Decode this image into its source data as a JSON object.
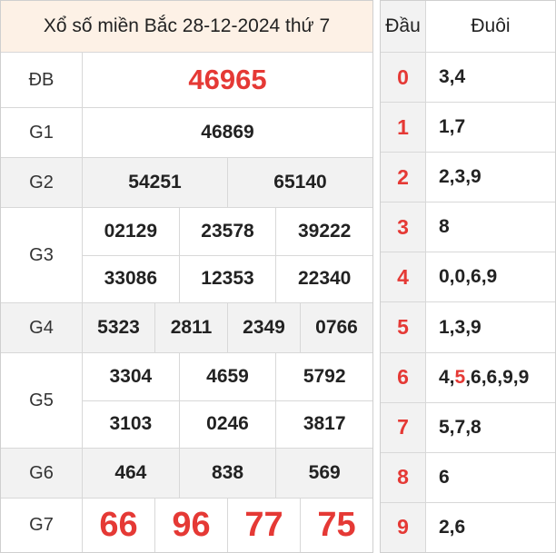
{
  "results": {
    "title": "Xổ số miền Bắc 28-12-2024 thứ 7",
    "prizes": {
      "db": {
        "label": "ĐB",
        "values": [
          "46965"
        ]
      },
      "g1": {
        "label": "G1",
        "values": [
          "46869"
        ]
      },
      "g2": {
        "label": "G2",
        "values": [
          "54251",
          "65140"
        ]
      },
      "g3": {
        "label": "G3",
        "values": [
          "02129",
          "23578",
          "39222",
          "33086",
          "12353",
          "22340"
        ]
      },
      "g4": {
        "label": "G4",
        "values": [
          "5323",
          "2811",
          "2349",
          "0766"
        ]
      },
      "g5": {
        "label": "G5",
        "values": [
          "3304",
          "4659",
          "5792",
          "3103",
          "0246",
          "3817"
        ]
      },
      "g6": {
        "label": "G6",
        "values": [
          "464",
          "838",
          "569"
        ]
      },
      "g7": {
        "label": "G7",
        "values": [
          "66",
          "96",
          "77",
          "75"
        ]
      }
    }
  },
  "loto": {
    "head_label": "Đầu",
    "tail_label": "Đuôi",
    "rows": [
      {
        "head": "0",
        "tails": [
          {
            "t": "3,4"
          }
        ]
      },
      {
        "head": "1",
        "tails": [
          {
            "t": "1,7"
          }
        ]
      },
      {
        "head": "2",
        "tails": [
          {
            "t": "2,3,9"
          }
        ]
      },
      {
        "head": "3",
        "tails": [
          {
            "t": "8"
          }
        ]
      },
      {
        "head": "4",
        "tails": [
          {
            "t": "0,0,6,9"
          }
        ]
      },
      {
        "head": "5",
        "tails": [
          {
            "t": "1,3,9"
          }
        ]
      },
      {
        "head": "6",
        "tails": [
          {
            "t": "4,"
          },
          {
            "t": "5",
            "hl": true
          },
          {
            "t": ",6,6,9,9"
          }
        ]
      },
      {
        "head": "7",
        "tails": [
          {
            "t": "5,7,8"
          }
        ]
      },
      {
        "head": "8",
        "tails": [
          {
            "t": "6"
          }
        ]
      },
      {
        "head": "9",
        "tails": [
          {
            "t": "2,6"
          }
        ]
      }
    ]
  },
  "colors": {
    "accent_red": "#e53935",
    "header_bg": "#fdf1e6",
    "shade_bg": "#f2f2f2"
  }
}
